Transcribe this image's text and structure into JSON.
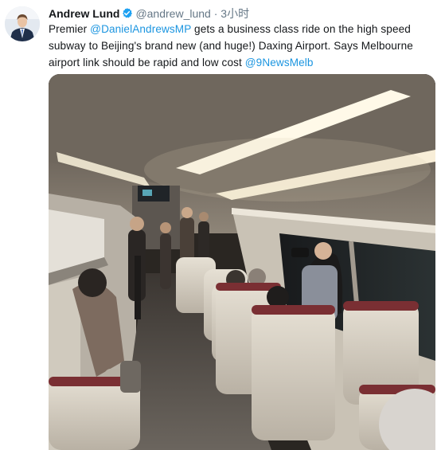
{
  "tweet": {
    "author_name": "Andrew Lund",
    "handle": "@andrew_lund",
    "separator": "·",
    "time": "3小时",
    "text_parts": {
      "p1": "Premier ",
      "mention1": "@DanielAndrewsMP",
      "p2": " gets a business class ride on the high speed subway to Beijing's brand new (and huge!) Daxing Airport. Says Melbourne airport link should be rapid and low cost ",
      "mention2": "@9NewsMelb"
    }
  },
  "icons": {
    "verified": "verified-badge-icon",
    "avatar": "profile-avatar"
  },
  "colors": {
    "link": "#1b95e0",
    "verified": "#1da1f2",
    "text": "#14171a",
    "meta": "#657786"
  }
}
